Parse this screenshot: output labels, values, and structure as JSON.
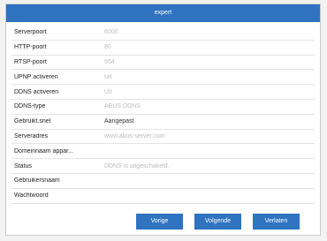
{
  "dialog": {
    "title": "expert",
    "rows": [
      {
        "label": "Serverpoort",
        "value": "6000",
        "emphasis": false
      },
      {
        "label": "HTTP-poort",
        "value": "80",
        "emphasis": false
      },
      {
        "label": "RTSP-poort",
        "value": "554",
        "emphasis": false
      },
      {
        "label": "UPNP activeren",
        "value": "Uit",
        "emphasis": false
      },
      {
        "label": "DDNS activeren",
        "value": "Uit",
        "emphasis": false
      },
      {
        "label": "DDNS-type",
        "value": "ABUS DDNS",
        "emphasis": false
      },
      {
        "label": "Gebruikt.snel",
        "value": "Aangepast",
        "emphasis": true
      },
      {
        "label": "Serveradres",
        "value": "www.abus-server.com",
        "emphasis": false
      },
      {
        "label": "Domeinnaam appar...",
        "value": "",
        "emphasis": false
      },
      {
        "label": "Status",
        "value": "DDNS is uitgeschakeld.",
        "emphasis": false
      },
      {
        "label": "Gebruikersnaam",
        "value": "",
        "emphasis": false
      },
      {
        "label": "Wachtwoord",
        "value": "",
        "emphasis": false
      }
    ],
    "buttons": {
      "prev": "Vorige",
      "next": "Volgende",
      "exit": "Verlaten"
    }
  },
  "colors": {
    "accent": "#2f73c1"
  }
}
